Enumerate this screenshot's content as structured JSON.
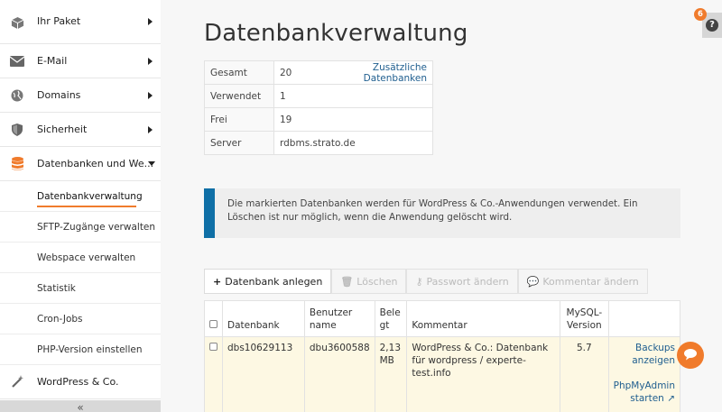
{
  "sidebar": {
    "items": [
      {
        "label": "Ihr Paket",
        "icon": "package-icon"
      },
      {
        "label": "E-Mail",
        "icon": "mail-icon"
      },
      {
        "label": "Domains",
        "icon": "globe-icon"
      },
      {
        "label": "Sicherheit",
        "icon": "shield-icon"
      },
      {
        "label": "Datenbanken und We...",
        "icon": "database-icon"
      }
    ],
    "subitems": [
      {
        "label": "Datenbankverwaltung"
      },
      {
        "label": "SFTP-Zugänge verwalten"
      },
      {
        "label": "Webspace verwalten"
      },
      {
        "label": "Statistik"
      },
      {
        "label": "Cron-Jobs"
      },
      {
        "label": "PHP-Version einstellen"
      }
    ],
    "wordpress": {
      "label": "WordPress & Co.",
      "icon": "wand-icon"
    },
    "collapse_label": "«"
  },
  "main": {
    "title": "Datenbankverwaltung",
    "info": {
      "rows": [
        {
          "key": "Gesamt",
          "value": "20",
          "link": "Zusätzliche Datenbanken"
        },
        {
          "key": "Verwendet",
          "value": "1"
        },
        {
          "key": "Frei",
          "value": "19"
        },
        {
          "key": "Server",
          "value": "rdbms.strato.de"
        }
      ]
    },
    "notice": "Die markierten Datenbanken werden für WordPress & Co.-Anwendungen verwendet. Ein Löschen ist nur möglich, wenn die Anwendung gelöscht wird.",
    "toolbar": {
      "create": "Datenbank anlegen",
      "delete": "Löschen",
      "password": "Passwort ändern",
      "comment": "Kommentar ändern"
    },
    "table": {
      "headers": {
        "db": "Datenbank",
        "user": "Benutzer name",
        "used": "Bele gt",
        "comment": "Kommentar",
        "mysql": "MySQL-Version"
      },
      "rows": [
        {
          "db": "dbs10629113",
          "user": "dbu3600588",
          "used": "2,13 MB",
          "comment": "WordPress & Co.: Datenbank für wordpress / experte-test.info",
          "mysql": "5.7",
          "backups": "Backups anzeigen",
          "phpmyadmin": "PhpMyAdmin starten"
        }
      ]
    }
  },
  "help": {
    "badge": "6",
    "label": "?"
  },
  "colors": {
    "accent": "#f07b2c",
    "info_bar": "#0f6fa6",
    "link": "#1f5e8f",
    "highlight_row": "#fdf8e3"
  }
}
